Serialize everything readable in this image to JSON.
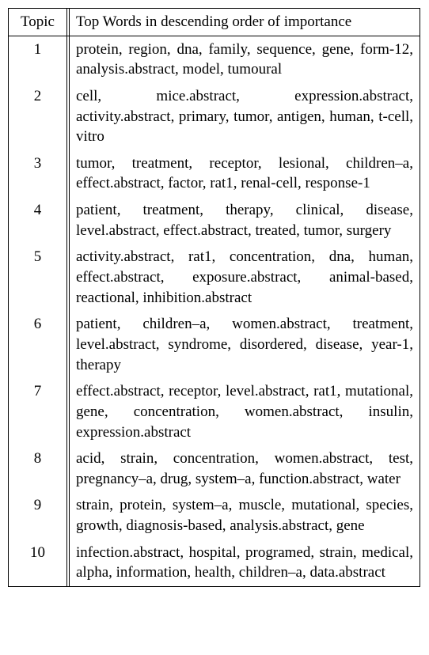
{
  "header": {
    "topic": "Topic",
    "desc": "Top Words in descending order of importance"
  },
  "rows": [
    {
      "n": "1",
      "words": "protein, region, dna, family, sequence, gene, form-12, analysis.abstract, model, tumoural"
    },
    {
      "n": "2",
      "words": "cell, mice.abstract, expression.abstract, activity.abstract, primary, tumor, antigen, human, t-cell, vitro"
    },
    {
      "n": "3",
      "words": "tumor, treatment, receptor, lesional, children–a, effect.abstract, factor, rat1, renal-cell, response-1"
    },
    {
      "n": "4",
      "words": "patient, treatment, therapy, clinical, disease, level.abstract, effect.abstract, treated, tumor, surgery"
    },
    {
      "n": "5",
      "words": "activity.abstract, rat1, concentration, dna, human, effect.abstract, exposure.abstract, animal-based, reactional, inhibition.abstract"
    },
    {
      "n": "6",
      "words": "patient, children–a, women.abstract, treatment, level.abstract, syndrome, disordered, disease, year-1, therapy"
    },
    {
      "n": "7",
      "words": "effect.abstract, receptor, level.abstract, rat1, mutational, gene, concentration, women.abstract, insulin, expression.abstract"
    },
    {
      "n": "8",
      "words": "acid, strain, concentration, women.abstract, test, pregnancy–a, drug, system–a, function.abstract, water"
    },
    {
      "n": "9",
      "words": "strain, protein, system–a, muscle, mutational, species, growth, diagnosis-based, analysis.abstract, gene"
    },
    {
      "n": "10",
      "words": "infection.abstract, hospital, programed, strain, medical, alpha, information, health, children–a, data.abstract"
    }
  ],
  "chart_data": {
    "type": "table",
    "title": "Top Words in descending order of importance",
    "columns": [
      "Topic",
      "Top Words"
    ],
    "rows": [
      [
        1,
        [
          "protein",
          "region",
          "dna",
          "family",
          "sequence",
          "gene",
          "form-12",
          "analysis.abstract",
          "model",
          "tumoural"
        ]
      ],
      [
        2,
        [
          "cell",
          "mice.abstract",
          "expression.abstract",
          "activity.abstract",
          "primary",
          "tumor",
          "antigen",
          "human",
          "t-cell",
          "vitro"
        ]
      ],
      [
        3,
        [
          "tumor",
          "treatment",
          "receptor",
          "lesional",
          "children–a",
          "effect.abstract",
          "factor",
          "rat1",
          "renal-cell",
          "response-1"
        ]
      ],
      [
        4,
        [
          "patient",
          "treatment",
          "therapy",
          "clinical",
          "disease",
          "level.abstract",
          "effect.abstract",
          "treated",
          "tumor",
          "surgery"
        ]
      ],
      [
        5,
        [
          "activity.abstract",
          "rat1",
          "concentration",
          "dna",
          "human",
          "effect.abstract",
          "exposure.abstract",
          "animal-based",
          "reactional",
          "inhibition.abstract"
        ]
      ],
      [
        6,
        [
          "patient",
          "children–a",
          "women.abstract",
          "treatment",
          "level.abstract",
          "syndrome",
          "disordered",
          "disease",
          "year-1",
          "therapy"
        ]
      ],
      [
        7,
        [
          "effect.abstract",
          "receptor",
          "level.abstract",
          "rat1",
          "mutational",
          "gene",
          "concentration",
          "women.abstract",
          "insulin",
          "expression.abstract"
        ]
      ],
      [
        8,
        [
          "acid",
          "strain",
          "concentration",
          "women.abstract",
          "test",
          "pregnancy–a",
          "drug",
          "system–a",
          "function.abstract",
          "water"
        ]
      ],
      [
        9,
        [
          "strain",
          "protein",
          "system–a",
          "muscle",
          "mutational",
          "species",
          "growth",
          "diagnosis-based",
          "analysis.abstract",
          "gene"
        ]
      ],
      [
        10,
        [
          "infection.abstract",
          "hospital",
          "programed",
          "strain",
          "medical",
          "alpha",
          "information",
          "health",
          "children–a",
          "data.abstract"
        ]
      ]
    ]
  }
}
